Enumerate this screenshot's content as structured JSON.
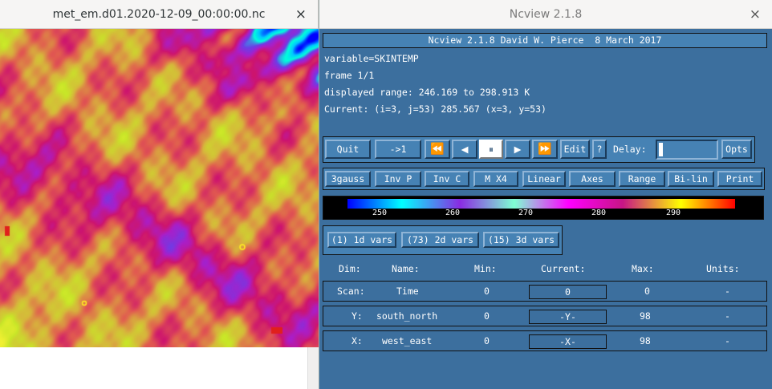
{
  "image_window": {
    "title": "met_em.d01.2020-12-09_00:00:00.nc",
    "close_label": "×"
  },
  "ncview_window": {
    "title": "Ncview 2.1.8",
    "close_label": "×",
    "banner": "Ncview 2.1.8 David W. Pierce  8 March 2017",
    "variable": "variable=SKINTEMP",
    "frame": "frame 1/1",
    "range": "displayed range: 246.169 to 298.913 K",
    "current": "Current: (i=3, j=53) 285.567 (x=3, y=53)"
  },
  "controls": {
    "quit": "Quit",
    "to_one": "->1",
    "rewind": "⏪",
    "back": "◀",
    "pause": "⏸",
    "forward": "▶",
    "fast_forward": "⏩",
    "edit": "Edit",
    "help": "?",
    "delay_label": "Delay:",
    "opts": "Opts"
  },
  "options": [
    "3gauss",
    "Inv P",
    "Inv C",
    "M X4",
    "Linear",
    "Axes",
    "Range",
    "Bi-lin",
    "Print"
  ],
  "colorbar": {
    "ticks": [
      "250",
      "260",
      "270",
      "280",
      "290"
    ],
    "colors": [
      "#0000ff",
      "#00ffff",
      "#8a2be2",
      "#7fffd4",
      "#ff00ff",
      "#c71585",
      "#ffff00",
      "#ff0000"
    ]
  },
  "var_groups": [
    "(1) 1d vars",
    "(73) 2d vars",
    "(15) 3d vars"
  ],
  "dims_header": {
    "dim": "Dim:",
    "name": "Name:",
    "min": "Min:",
    "current": "Current:",
    "max": "Max:",
    "units": "Units:"
  },
  "dims": [
    {
      "dim": "Scan:",
      "name": "Time",
      "min": "0",
      "current": "0",
      "max": "0",
      "units": "-"
    },
    {
      "dim": "Y:",
      "name": "south_north",
      "min": "0",
      "current": "-Y-",
      "max": "98",
      "units": "-"
    },
    {
      "dim": "X:",
      "name": "west_east",
      "min": "0",
      "current": "-X-",
      "max": "98",
      "units": "-"
    }
  ]
}
